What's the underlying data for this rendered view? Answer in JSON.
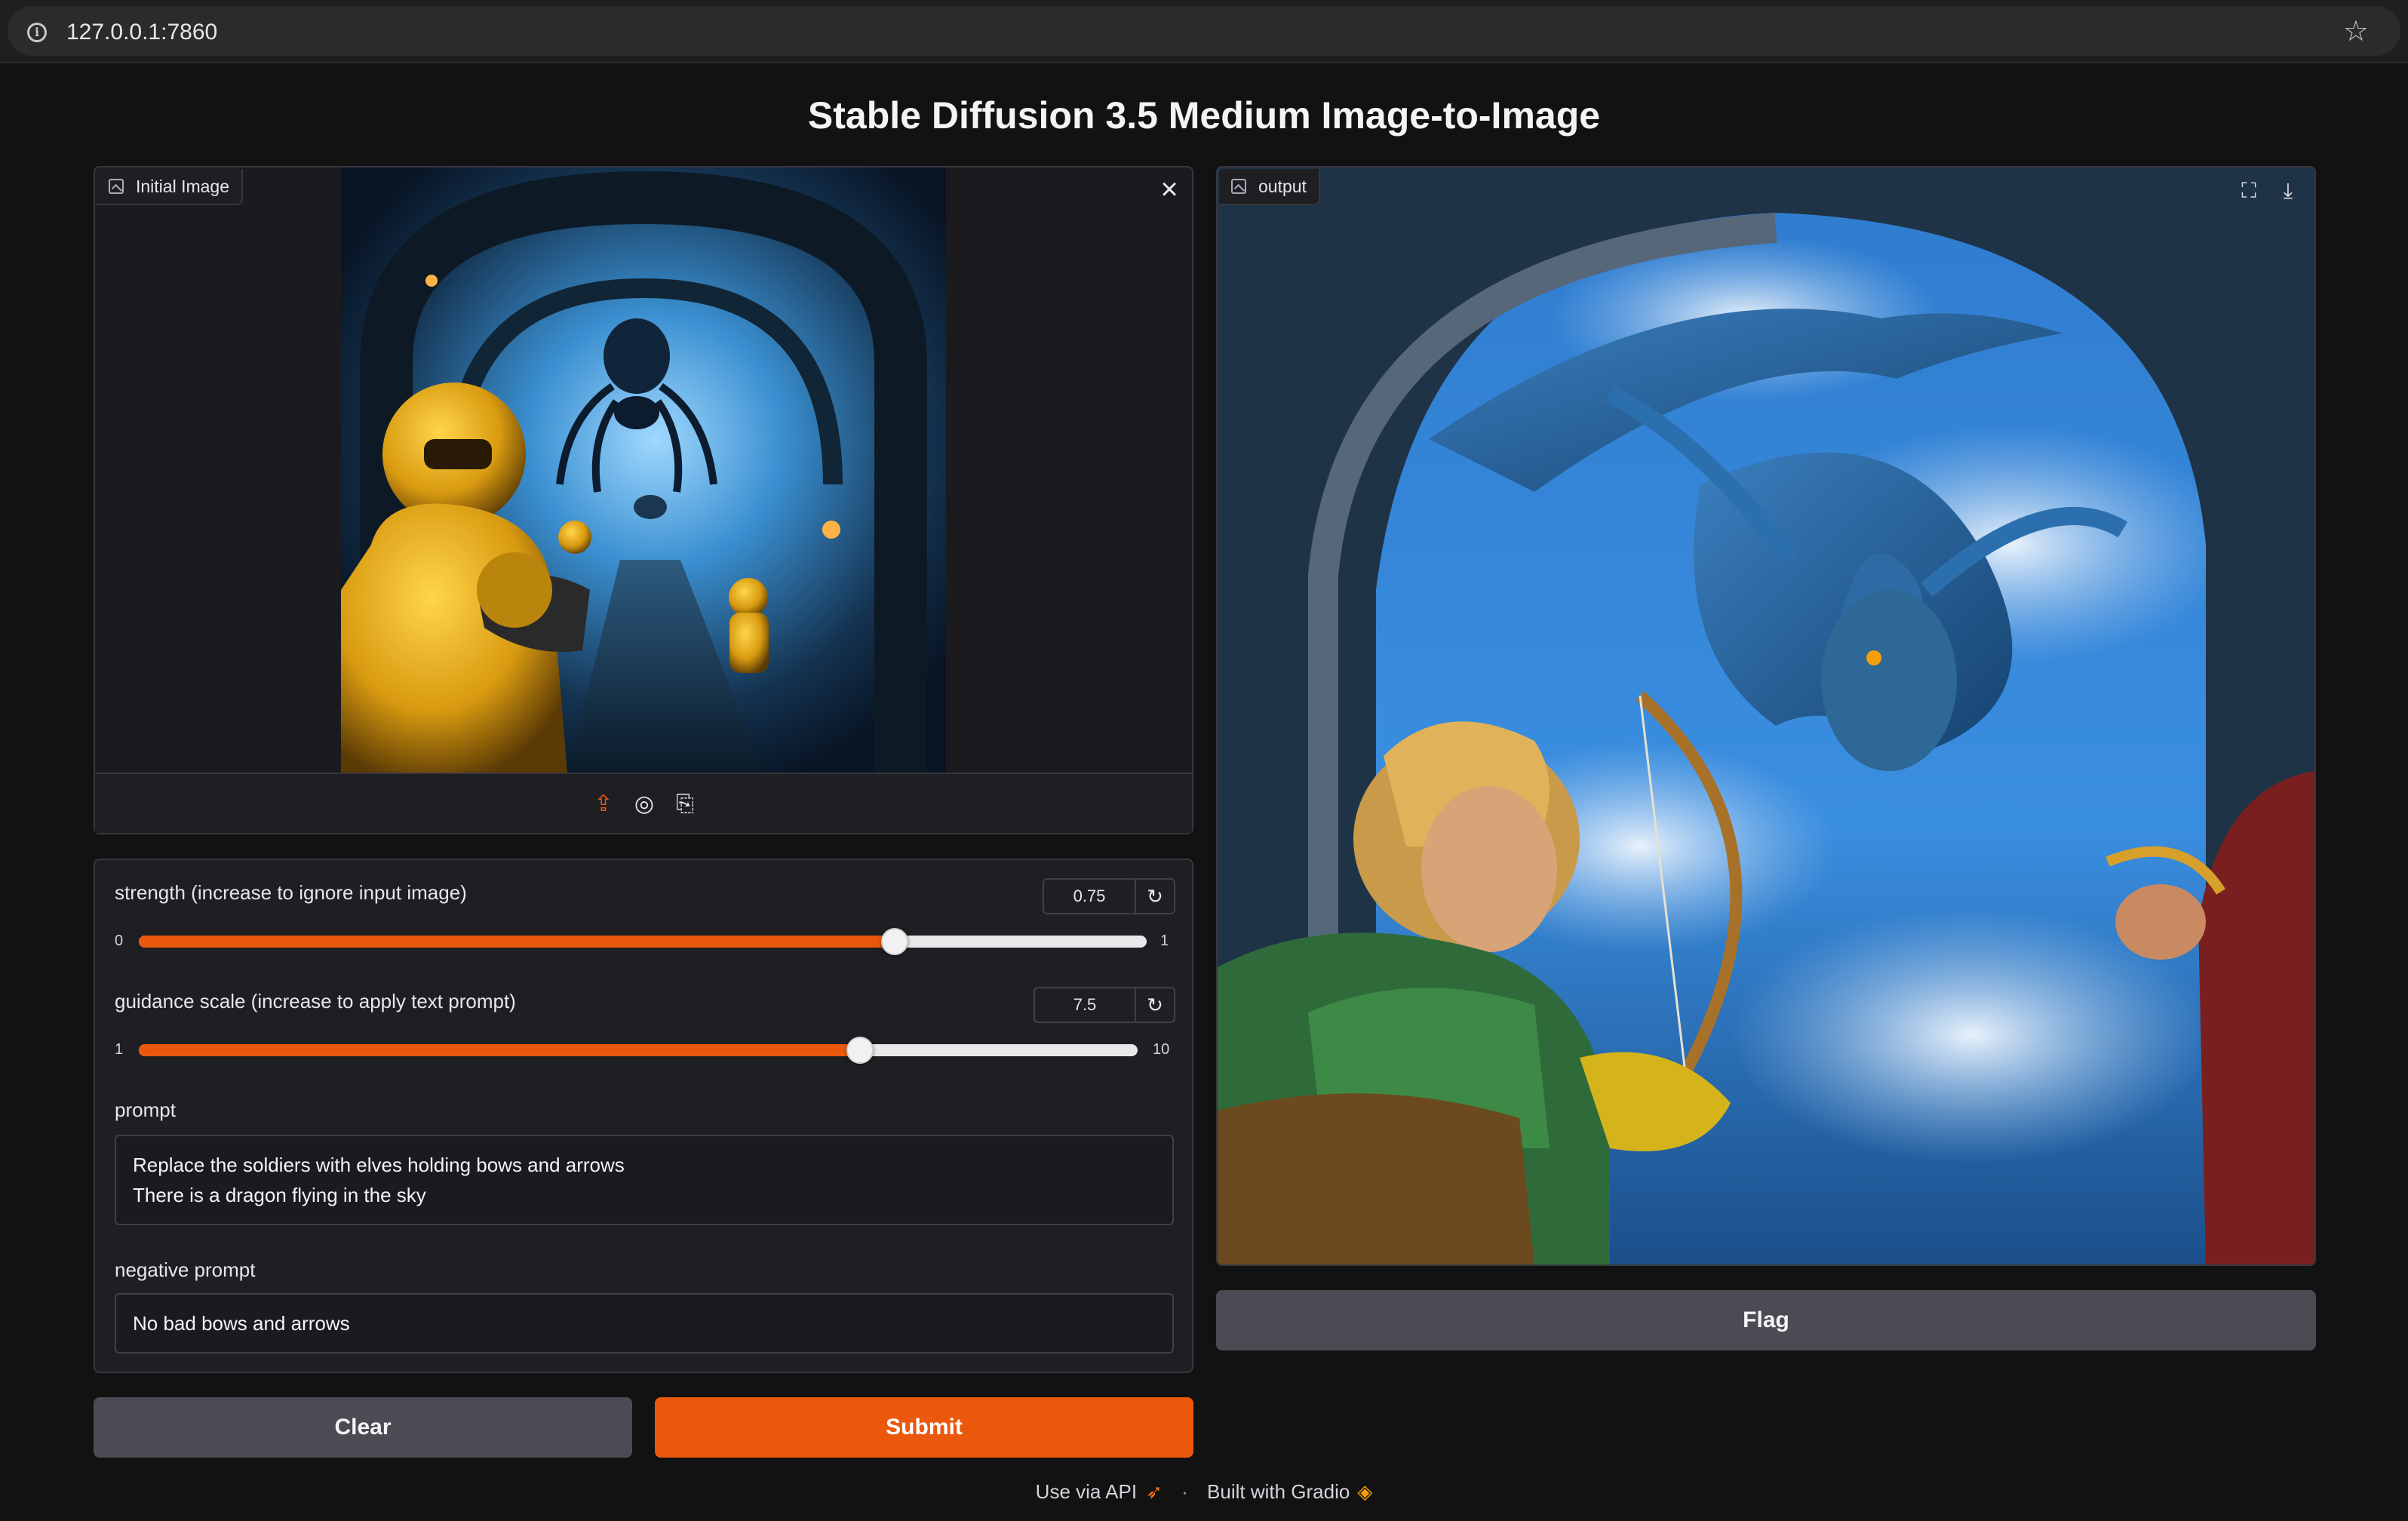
{
  "browser": {
    "url": "127.0.0.1:7860"
  },
  "title": "Stable Diffusion 3.5 Medium Image-to-Image",
  "input_image": {
    "label": "Initial Image",
    "toolbar": [
      "upload-icon",
      "webcam-icon",
      "clipboard-icon"
    ]
  },
  "output_image": {
    "label": "output"
  },
  "controls": {
    "strength": {
      "label": "strength (increase to ignore input image)",
      "value": "0.75",
      "min": "0",
      "max": "1",
      "fraction": 0.75
    },
    "guidance": {
      "label": "guidance scale (increase to apply text prompt)",
      "value": "7.5",
      "min": "1",
      "max": "10",
      "fraction": 0.7222
    },
    "prompt": {
      "label": "prompt",
      "line1": "Replace the soldiers with elves holding bows and arrows",
      "line2": "There is a dragon flying in the sky"
    },
    "negative_prompt": {
      "label": "negative prompt",
      "value": "No bad bows and arrows"
    }
  },
  "buttons": {
    "clear": "Clear",
    "submit": "Submit",
    "flag": "Flag"
  },
  "footer": {
    "api": "Use via API",
    "separator": "·",
    "built": "Built with Gradio"
  },
  "colors": {
    "accent": "#ea580c",
    "background": "#121212",
    "panel": "#1f1f23"
  }
}
